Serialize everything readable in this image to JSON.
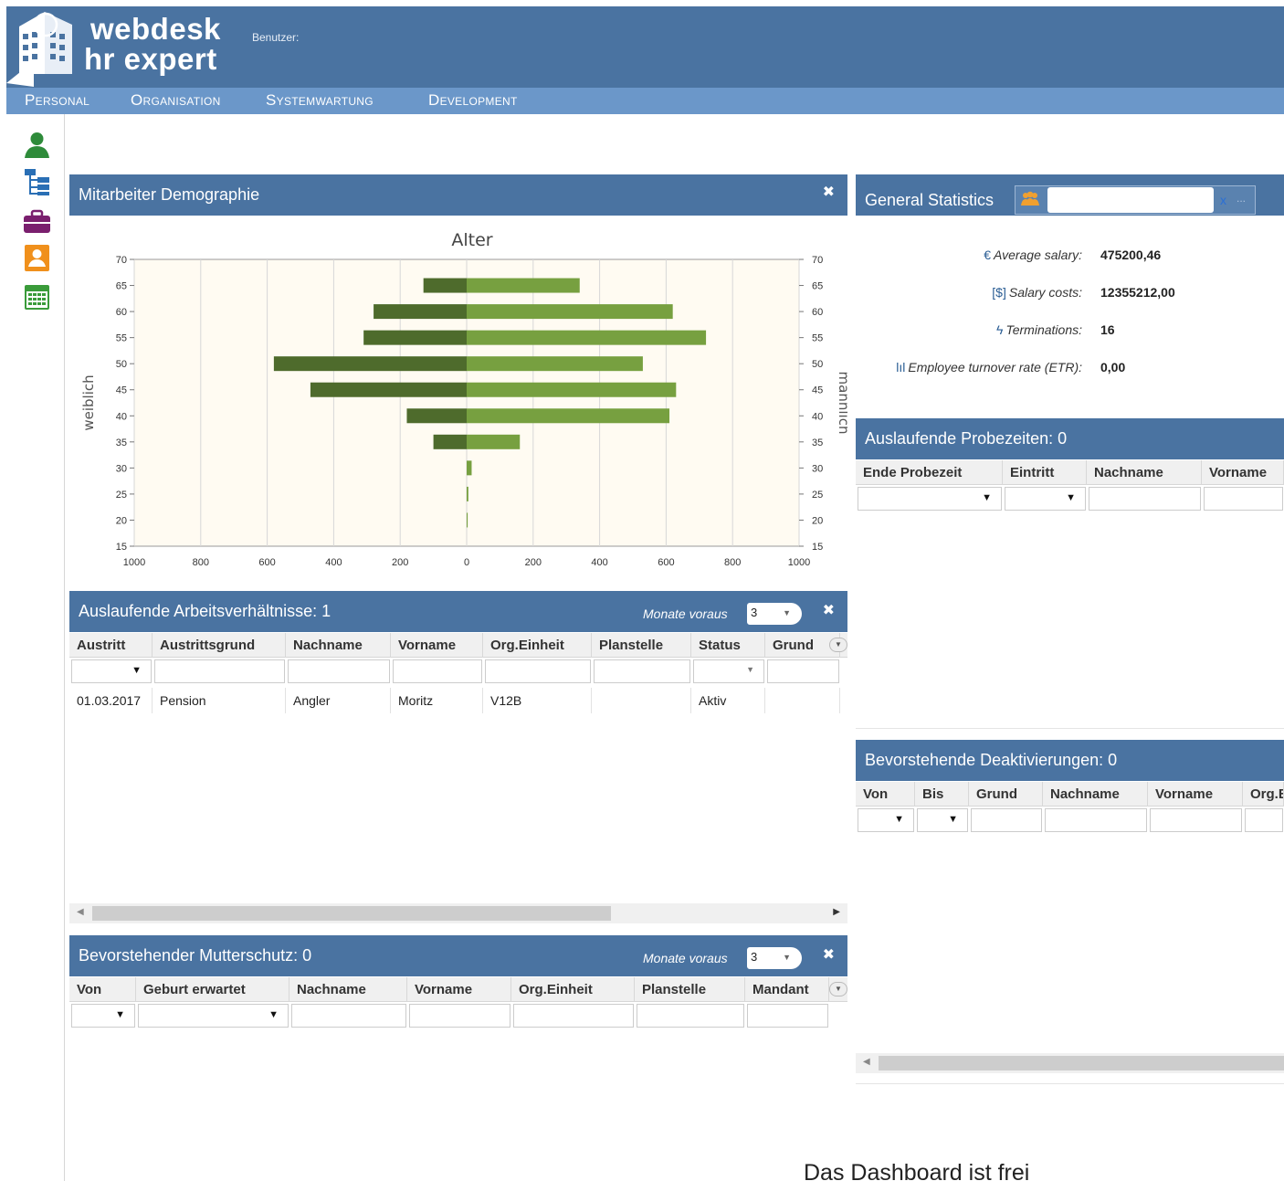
{
  "app": {
    "logo_line1": "webdesk",
    "logo_line2": "hr expert",
    "user_label": "Benutzer:"
  },
  "menu": [
    {
      "label": "Personal"
    },
    {
      "label": "Organisation"
    },
    {
      "label": "Systemwartung"
    },
    {
      "label": "Development"
    }
  ],
  "left_toolbar": [
    "person-icon",
    "org-tree-icon",
    "briefcase-icon",
    "contact-card-icon",
    "calendar-icon"
  ],
  "demographie": {
    "title": "Mitarbeiter Demographie",
    "close": "✖",
    "chart_data": {
      "type": "bar",
      "title": "Alter",
      "left_label": "weiblich",
      "right_label": "männlich",
      "y_ticks": [
        "70",
        "65",
        "60",
        "55",
        "50",
        "45",
        "40",
        "35",
        "30",
        "25",
        "20",
        "15"
      ],
      "x_ticks": [
        "1000",
        "800",
        "600",
        "400",
        "200",
        "0",
        "200",
        "400",
        "600",
        "800",
        "1000"
      ],
      "xlim": [
        -1000,
        1000
      ],
      "ylim": [
        15,
        70
      ],
      "categories": [
        "65",
        "60",
        "55",
        "50",
        "45",
        "40",
        "35",
        "30",
        "25",
        "20"
      ],
      "series": [
        {
          "name": "weiblich",
          "color": "#4e6b2c",
          "values": [
            130,
            280,
            310,
            580,
            470,
            180,
            100,
            0,
            0,
            0
          ]
        },
        {
          "name": "männlich",
          "color": "#77a040",
          "values": [
            340,
            620,
            720,
            530,
            630,
            610,
            160,
            15,
            5,
            3
          ]
        }
      ]
    }
  },
  "stats": {
    "title": "General Statistics",
    "rows": [
      {
        "icon": "€",
        "label": "Average salary:",
        "value": "475200,46"
      },
      {
        "icon": "[$]",
        "label": "Salary costs:",
        "value": "12355212,00"
      },
      {
        "icon": "ϟ",
        "label": "Terminations:",
        "value": "16"
      },
      {
        "icon": "lıl",
        "label": "Employee turnover rate (ETR):",
        "value": "0,00"
      }
    ]
  },
  "arbeitsverh": {
    "title": "Auslaufende Arbeitsverhältnisse: 1",
    "months_label": "Monate voraus",
    "months_value": "3",
    "close": "✖",
    "columns": [
      "Austritt",
      "Austrittsgrund",
      "Nachname",
      "Vorname",
      "Org.Einheit",
      "Planstelle",
      "Status",
      "Grund"
    ],
    "rows": [
      [
        "01.03.2017",
        "Pension",
        "Angler",
        "Moritz",
        "V12B",
        "",
        "Aktiv",
        ""
      ]
    ]
  },
  "mutterschutz": {
    "title": "Bevorstehender Mutterschutz: 0",
    "months_label": "Monate voraus",
    "months_value": "3",
    "close": "✖",
    "columns": [
      "Von",
      "Geburt erwartet",
      "Nachname",
      "Vorname",
      "Org.Einheit",
      "Planstelle",
      "Mandant"
    ]
  },
  "probezeiten": {
    "title": "Auslaufende Probezeiten: 0",
    "columns": [
      "Ende Probezeit",
      "Eintritt",
      "Nachname",
      "Vorname"
    ]
  },
  "deaktivierungen": {
    "title": "Bevorstehende Deaktivierungen: 0",
    "columns": [
      "Von",
      "Bis",
      "Grund",
      "Nachname",
      "Vorname",
      "Org.E"
    ]
  },
  "footer": "Das Dashboard ist frei"
}
